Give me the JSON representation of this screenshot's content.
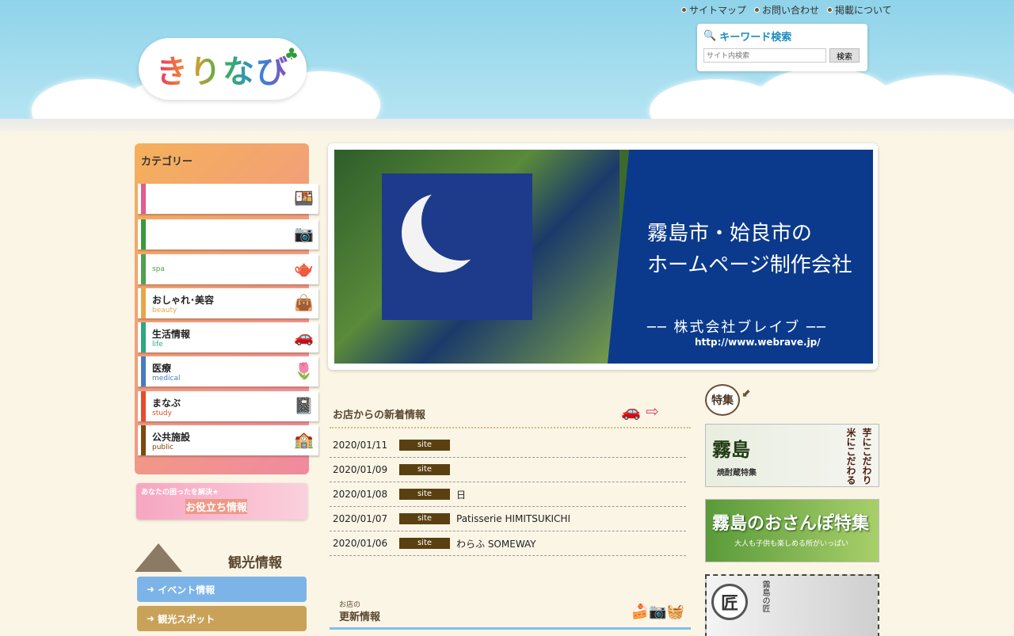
{
  "site": {
    "logo_text": "きりなび",
    "top_links": [
      "サイトマップ",
      "お問い合わせ",
      "掲載について"
    ]
  },
  "search": {
    "title": "キーワード検索",
    "placeholder": "サイト内検索",
    "button_label": "検索"
  },
  "sidebar": {
    "category_title": "カテゴリー",
    "items": [
      {
        "label": "",
        "sub": "",
        "color": "#e65a8c",
        "icon": "food-icon"
      },
      {
        "label": "",
        "sub": "",
        "color": "#3a9a3a",
        "icon": "camera-icon"
      },
      {
        "label": "",
        "sub": "spa",
        "color": "#4ea24e",
        "icon": "teapot-icon"
      },
      {
        "label": "おしゃれ･美容",
        "sub": "beauty",
        "color": "#e7a64a",
        "icon": "bag-icon"
      },
      {
        "label": "生活情報",
        "sub": "life",
        "color": "#2ea87e",
        "icon": "car-icon"
      },
      {
        "label": "医療",
        "sub": "medical",
        "color": "#4a7bc0",
        "icon": "flower-icon"
      },
      {
        "label": "まなぶ",
        "sub": "study",
        "color": "#e84c2a",
        "icon": "notebook-icon"
      },
      {
        "label": "公共施設",
        "sub": "public",
        "color": "#7a4a10",
        "icon": "building-icon"
      }
    ],
    "helpful_small": "あなたの困ったを解決★",
    "helpful_main": "お役立ち情報",
    "tourism_title": "観光情報",
    "tourism_buttons": [
      {
        "label": "イベント情報",
        "color": "#7cb4e8"
      },
      {
        "label": "観光スポット",
        "color": "#c9a25a"
      }
    ]
  },
  "hero": {
    "line1": "霧島市・姶良市の",
    "line2": "ホームページ制作会社",
    "company": "── 株式会社ブレイブ ──",
    "url": "http://www.webrave.jp/"
  },
  "news": {
    "title": "お店からの新着情報",
    "rows": [
      {
        "date": "2020/01/11",
        "tag": "site",
        "text": ""
      },
      {
        "date": "2020/01/09",
        "tag": "site",
        "text": ""
      },
      {
        "date": "2020/01/08",
        "tag": "site",
        "text": "日"
      },
      {
        "date": "2020/01/07",
        "tag": "site",
        "text": "Patisserie HIMITSUKICHI"
      },
      {
        "date": "2020/01/06",
        "tag": "site",
        "text": "わらふ SOMEWAY"
      }
    ]
  },
  "update": {
    "small": "お店の",
    "title": "更新情報"
  },
  "feature": {
    "label": "特集",
    "banners": [
      {
        "title": "霧島",
        "sub": "焼酎蔵特集",
        "imo": "芋にこだわり",
        "kome": "米にこだわる"
      },
      {
        "title": "霧島のおさんぽ特集",
        "sub": "大人も子供も楽しめる所がいっぱい"
      },
      {
        "circle": "匠",
        "text": "霧島の匠"
      }
    ]
  }
}
